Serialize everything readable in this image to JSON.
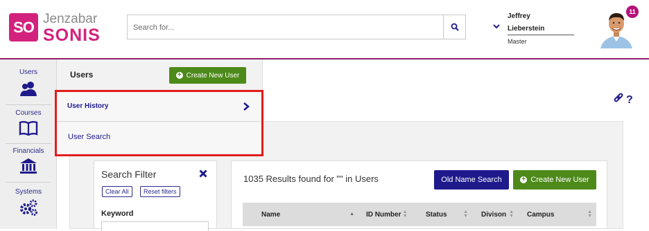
{
  "brand": {
    "logo_text": "SO",
    "name_top": "Jenzabar",
    "name_bottom": "SONIS"
  },
  "search": {
    "placeholder": "Search for..."
  },
  "user": {
    "first": "Jeffrey",
    "last": "Lieberstein",
    "role": "Master",
    "notifications": "11"
  },
  "rail": [
    {
      "label": "Users",
      "icon": "users-icon"
    },
    {
      "label": "Courses",
      "icon": "book-icon"
    },
    {
      "label": "Financials",
      "icon": "bank-icon"
    },
    {
      "label": "Systems",
      "icon": "gears-icon"
    }
  ],
  "flyout": {
    "title": "Users",
    "create_label": "Create New User",
    "items": [
      {
        "label": "User History"
      },
      {
        "label": "User Search"
      }
    ]
  },
  "filter": {
    "title": "Search Filter",
    "clear_label": "Clear All",
    "reset_label": "Reset filters",
    "keyword_label": "Keyword"
  },
  "results": {
    "summary": "1035 Results found for \"\" in Users",
    "old_name_label": "Old Name Search",
    "create_label": "Create New User",
    "columns": [
      "Name",
      "ID Number",
      "Status",
      "Divison",
      "Campus"
    ]
  },
  "colors": {
    "brand_pink": "#d3227d",
    "header_rule": "#8e1f6e",
    "green": "#4d8a1a",
    "navy": "#1e1a8c",
    "highlight": "#e21c1c"
  }
}
